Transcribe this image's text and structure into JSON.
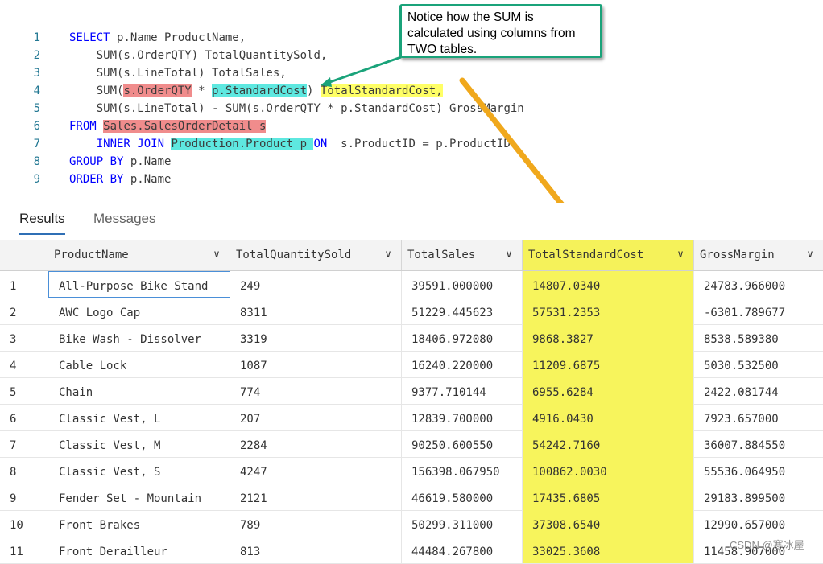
{
  "editor": {
    "lines": [
      {
        "num": "1",
        "indent": "",
        "segments": [
          {
            "t": "SELECT",
            "c": "kw"
          },
          {
            "t": " p.Name ProductName,",
            "c": ""
          }
        ]
      },
      {
        "num": "2",
        "indent": "    ",
        "segments": [
          {
            "t": "SUM(s.OrderQTY) TotalQuantitySold,",
            "c": ""
          }
        ]
      },
      {
        "num": "3",
        "indent": "    ",
        "segments": [
          {
            "t": "SUM(s.LineTotal) TotalSales,",
            "c": ""
          }
        ]
      },
      {
        "num": "4",
        "indent": "    ",
        "segments": [
          {
            "t": "SUM(",
            "c": ""
          },
          {
            "t": "s.OrderQTY",
            "c": "hl-red"
          },
          {
            "t": " * ",
            "c": ""
          },
          {
            "t": "p.StandardCost",
            "c": "hl-cyan"
          },
          {
            "t": ") ",
            "c": ""
          },
          {
            "t": "TotalStandardCost,",
            "c": "hl-yellow"
          }
        ]
      },
      {
        "num": "5",
        "indent": "    ",
        "segments": [
          {
            "t": "SUM(s.LineTotal) - SUM(s.OrderQTY * p.StandardCost) GrossMargin",
            "c": ""
          }
        ]
      },
      {
        "num": "6",
        "indent": "",
        "segments": [
          {
            "t": "FROM",
            "c": "kw"
          },
          {
            "t": " ",
            "c": ""
          },
          {
            "t": "Sales.SalesOrderDetail s",
            "c": "hl-red"
          }
        ]
      },
      {
        "num": "7",
        "indent": "    ",
        "segments": [
          {
            "t": "INNER JOIN",
            "c": "kw"
          },
          {
            "t": " ",
            "c": ""
          },
          {
            "t": "Production.Product p ",
            "c": "hl-cyan"
          },
          {
            "t": "ON",
            "c": "kw"
          },
          {
            "t": "  s.ProductID = p.ProductID",
            "c": ""
          }
        ]
      },
      {
        "num": "8",
        "indent": "",
        "segments": [
          {
            "t": "GROUP BY",
            "c": "kw"
          },
          {
            "t": " p.Name",
            "c": ""
          }
        ]
      },
      {
        "num": "9",
        "indent": "",
        "segments": [
          {
            "t": "ORDER BY",
            "c": "kw"
          },
          {
            "t": " p.Name",
            "c": ""
          }
        ]
      }
    ]
  },
  "callout": {
    "line1": "Notice how the SUM is",
    "line2": "calculated using columns from",
    "line3": "TWO tables."
  },
  "tabs": {
    "results": "Results",
    "messages": "Messages"
  },
  "grid": {
    "columns": [
      "ProductName",
      "TotalQuantitySold",
      "TotalSales",
      "TotalStandardCost",
      "GrossMargin"
    ],
    "rows": [
      [
        "1",
        "All-Purpose Bike Stand",
        "249",
        "39591.000000",
        "14807.0340",
        "24783.966000"
      ],
      [
        "2",
        "AWC Logo Cap",
        "8311",
        "51229.445623",
        "57531.2353",
        "-6301.789677"
      ],
      [
        "3",
        "Bike Wash - Dissolver",
        "3319",
        "18406.972080",
        "9868.3827",
        "8538.589380"
      ],
      [
        "4",
        "Cable Lock",
        "1087",
        "16240.220000",
        "11209.6875",
        "5030.532500"
      ],
      [
        "5",
        "Chain",
        "774",
        "9377.710144",
        "6955.6284",
        "2422.081744"
      ],
      [
        "6",
        "Classic Vest, L",
        "207",
        "12839.700000",
        "4916.0430",
        "7923.657000"
      ],
      [
        "7",
        "Classic Vest, M",
        "2284",
        "90250.600550",
        "54242.7160",
        "36007.884550"
      ],
      [
        "8",
        "Classic Vest, S",
        "4247",
        "156398.067950",
        "100862.0030",
        "55536.064950"
      ],
      [
        "9",
        "Fender Set - Mountain",
        "2121",
        "46619.580000",
        "17435.6805",
        "29183.899500"
      ],
      [
        "10",
        "Front Brakes",
        "789",
        "50299.311000",
        "37308.6540",
        "12990.657000"
      ],
      [
        "11",
        "Front Derailleur",
        "813",
        "44484.267800",
        "33025.3608",
        "11458.907000"
      ]
    ]
  },
  "watermark": "CSDN @寒冰屋",
  "colors": {
    "highlight_yellow": "#f7f45c",
    "callout_border": "#1aa37a",
    "arrow": "#f0a81c"
  }
}
